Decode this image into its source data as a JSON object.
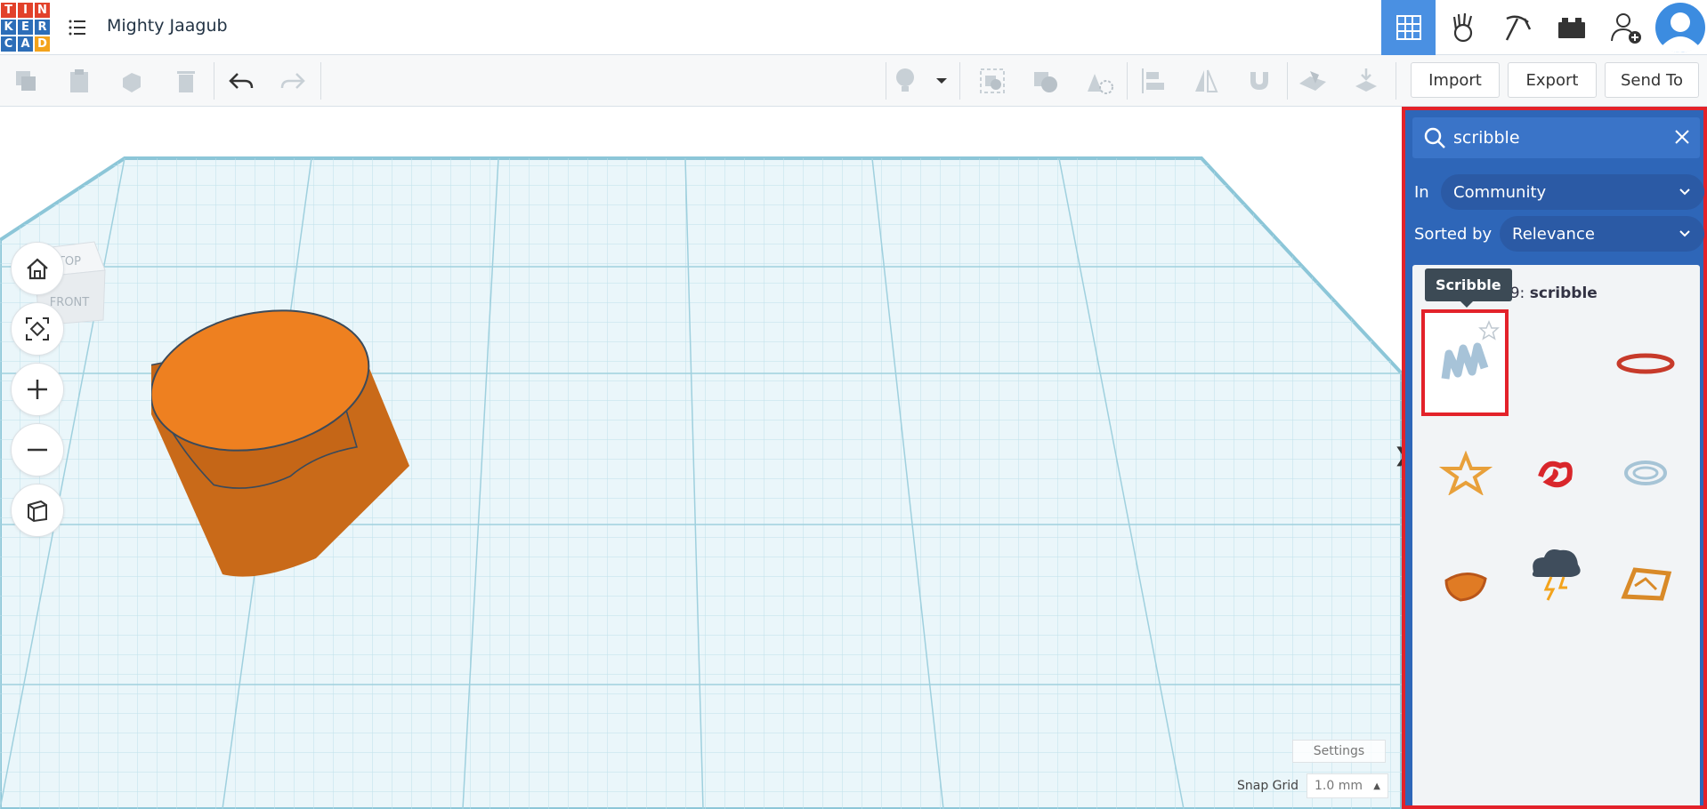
{
  "app": {
    "logo_letters": [
      "T",
      "I",
      "N",
      "K",
      "E",
      "R",
      "C",
      "A",
      "D"
    ],
    "logo_colors": [
      "#e2412a",
      "#e2412a",
      "#e2412a",
      "#2d6eb8",
      "#2d6eb8",
      "#2d6eb8",
      "#2d6eb8",
      "#2d6eb8",
      "#f3a31c"
    ],
    "design_title": "Mighty Jaagub"
  },
  "header": {
    "icons": [
      "grid-view-icon",
      "blocks-icon",
      "bricks-pickaxe-icon",
      "lego-brick-icon",
      "add-user-icon",
      "avatar-icon"
    ]
  },
  "toolbar": {
    "import_label": "Import",
    "export_label": "Export",
    "send_to_label": "Send To"
  },
  "viewcube": {
    "top_label": "TOP",
    "front_label": "FRONT"
  },
  "workplane": {
    "settings_label": "Settings",
    "snap_grid_label": "Snap Grid",
    "snap_grid_value": "1.0 mm",
    "shape_color": "#e8801f"
  },
  "panel": {
    "search_value": "scribble",
    "in_label": "In",
    "in_value": "Community",
    "sorted_label": "Sorted by",
    "sorted_value": "Relevance",
    "results_prefix": "und 9: ",
    "results_query": "scribble",
    "tooltip": "Scribble"
  }
}
